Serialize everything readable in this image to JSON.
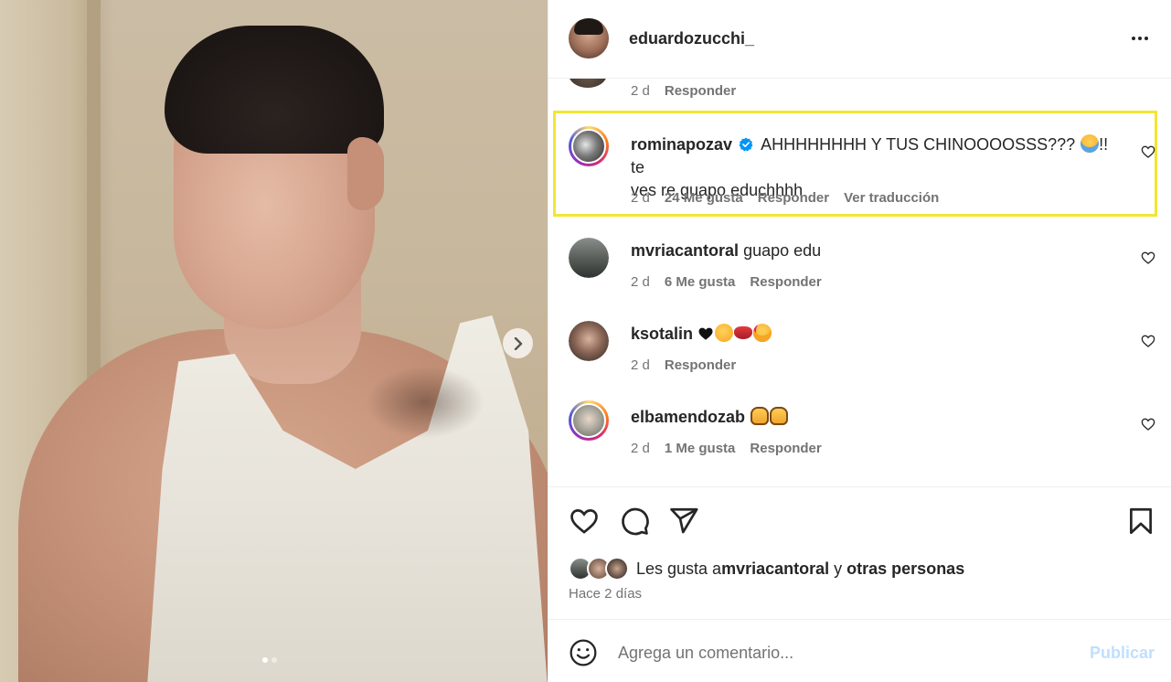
{
  "post": {
    "carousel_dots": 2,
    "active_dot": 0
  },
  "header": {
    "username": "eduardozucchi_",
    "more_icon": "more-horizontal-icon"
  },
  "comments": {
    "partial": {
      "time": "2 d",
      "reply": "Responder"
    },
    "items": [
      {
        "username": "rominapozav",
        "verified": true,
        "text_line1": "AHHHHHHHH Y TUS CHINOOOOSSS??? ",
        "text_line1_end": "!! te",
        "text_line2": "ves re guapo educhhhh",
        "time": "2 d",
        "likes": "24 Me gusta",
        "reply": "Responder",
        "translate": "Ver traducción"
      },
      {
        "username": "mvriacantoral",
        "text": "guapo edu",
        "time": "2 d",
        "likes": "6 Me gusta",
        "reply": "Responder"
      },
      {
        "username": "ksotalin",
        "text": "",
        "time": "2 d",
        "reply": "Responder"
      },
      {
        "username": "elbamendozab",
        "text": "",
        "time": "2 d",
        "likes": "1 Me gusta",
        "reply": "Responder"
      }
    ]
  },
  "actions": {
    "liked_by_prefix": "Les gusta a ",
    "liked_by_user": "mvriacantoral",
    "liked_by_mid": " y ",
    "liked_by_others": "otras personas",
    "date": "Hace 2 días"
  },
  "add_comment": {
    "placeholder": "Agrega un comentario...",
    "publish": "Publicar"
  },
  "colors": {
    "highlight": "#f2e634",
    "verified": "#0095f6",
    "publish_disabled": "#c0dffd"
  }
}
